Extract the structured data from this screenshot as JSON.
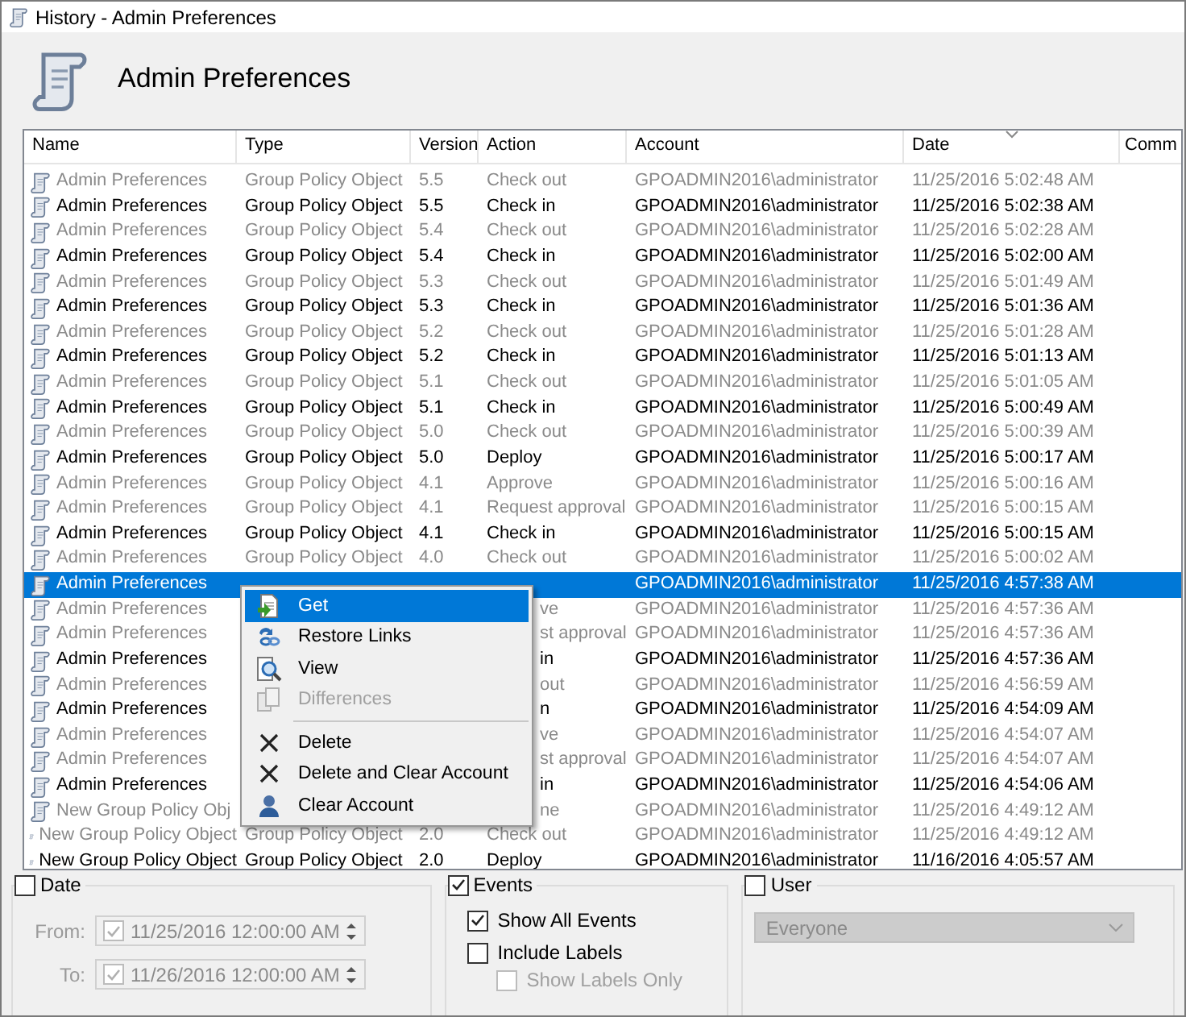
{
  "window": {
    "title": "History - Admin Preferences"
  },
  "header": {
    "title": "Admin Preferences"
  },
  "table": {
    "columns": [
      {
        "label": "Name",
        "sorted": false
      },
      {
        "label": "Type",
        "sorted": false
      },
      {
        "label": "Version",
        "sorted": false
      },
      {
        "label": "Action",
        "sorted": false
      },
      {
        "label": "Account",
        "sorted": false
      },
      {
        "label": "Date",
        "sorted": true
      },
      {
        "label": "Comm",
        "sorted": false
      }
    ],
    "rows": [
      {
        "kind": "past",
        "selected": false,
        "name": "Admin Preferences",
        "type": "Group Policy Object",
        "version": "5.5",
        "action": "Check out",
        "account": "GPOADMIN2016\\administrator",
        "date": "11/25/2016 5:02:48 AM"
      },
      {
        "kind": "current",
        "selected": false,
        "name": "Admin Preferences",
        "type": "Group Policy Object",
        "version": "5.5",
        "action": "Check in",
        "account": "GPOADMIN2016\\administrator",
        "date": "11/25/2016 5:02:38 AM"
      },
      {
        "kind": "past",
        "selected": false,
        "name": "Admin Preferences",
        "type": "Group Policy Object",
        "version": "5.4",
        "action": "Check out",
        "account": "GPOADMIN2016\\administrator",
        "date": "11/25/2016 5:02:28 AM"
      },
      {
        "kind": "current",
        "selected": false,
        "name": "Admin Preferences",
        "type": "Group Policy Object",
        "version": "5.4",
        "action": "Check in",
        "account": "GPOADMIN2016\\administrator",
        "date": "11/25/2016 5:02:00 AM"
      },
      {
        "kind": "past",
        "selected": false,
        "name": "Admin Preferences",
        "type": "Group Policy Object",
        "version": "5.3",
        "action": "Check out",
        "account": "GPOADMIN2016\\administrator",
        "date": "11/25/2016 5:01:49 AM"
      },
      {
        "kind": "current",
        "selected": false,
        "name": "Admin Preferences",
        "type": "Group Policy Object",
        "version": "5.3",
        "action": "Check in",
        "account": "GPOADMIN2016\\administrator",
        "date": "11/25/2016 5:01:36 AM"
      },
      {
        "kind": "past",
        "selected": false,
        "name": "Admin Preferences",
        "type": "Group Policy Object",
        "version": "5.2",
        "action": "Check out",
        "account": "GPOADMIN2016\\administrator",
        "date": "11/25/2016 5:01:28 AM"
      },
      {
        "kind": "current",
        "selected": false,
        "name": "Admin Preferences",
        "type": "Group Policy Object",
        "version": "5.2",
        "action": "Check in",
        "account": "GPOADMIN2016\\administrator",
        "date": "11/25/2016 5:01:13 AM"
      },
      {
        "kind": "past",
        "selected": false,
        "name": "Admin Preferences",
        "type": "Group Policy Object",
        "version": "5.1",
        "action": "Check out",
        "account": "GPOADMIN2016\\administrator",
        "date": "11/25/2016 5:01:05 AM"
      },
      {
        "kind": "current",
        "selected": false,
        "name": "Admin Preferences",
        "type": "Group Policy Object",
        "version": "5.1",
        "action": "Check in",
        "account": "GPOADMIN2016\\administrator",
        "date": "11/25/2016 5:00:49 AM"
      },
      {
        "kind": "past",
        "selected": false,
        "name": "Admin Preferences",
        "type": "Group Policy Object",
        "version": "5.0",
        "action": "Check out",
        "account": "GPOADMIN2016\\administrator",
        "date": "11/25/2016 5:00:39 AM"
      },
      {
        "kind": "current",
        "selected": false,
        "name": "Admin Preferences",
        "type": "Group Policy Object",
        "version": "5.0",
        "action": "Deploy",
        "account": "GPOADMIN2016\\administrator",
        "date": "11/25/2016 5:00:17 AM"
      },
      {
        "kind": "past",
        "selected": false,
        "name": "Admin Preferences",
        "type": "Group Policy Object",
        "version": "4.1",
        "action": "Approve",
        "account": "GPOADMIN2016\\administrator",
        "date": "11/25/2016 5:00:16 AM"
      },
      {
        "kind": "past",
        "selected": false,
        "name": "Admin Preferences",
        "type": "Group Policy Object",
        "version": "4.1",
        "action": "Request approval",
        "account": "GPOADMIN2016\\administrator",
        "date": "11/25/2016 5:00:15 AM"
      },
      {
        "kind": "current",
        "selected": false,
        "name": "Admin Preferences",
        "type": "Group Policy Object",
        "version": "4.1",
        "action": "Check in",
        "account": "GPOADMIN2016\\administrator",
        "date": "11/25/2016 5:00:15 AM"
      },
      {
        "kind": "past",
        "selected": false,
        "name": "Admin Preferences",
        "type": "Group Policy Object",
        "version": "4.0",
        "action": "Check out",
        "account": "GPOADMIN2016\\administrator",
        "date": "11/25/2016 5:00:02 AM"
      },
      {
        "kind": "current",
        "selected": true,
        "name": "Admin Preferences",
        "account": "GPOADMIN2016\\administrator",
        "date": "11/25/2016 4:57:38 AM"
      },
      {
        "kind": "past",
        "selected": false,
        "name": "Admin Preferences",
        "action": "ve",
        "account": "GPOADMIN2016\\administrator",
        "date": "11/25/2016 4:57:36 AM"
      },
      {
        "kind": "past",
        "selected": false,
        "name": "Admin Preferences",
        "action": "st approval",
        "account": "GPOADMIN2016\\administrator",
        "date": "11/25/2016 4:57:36 AM"
      },
      {
        "kind": "current",
        "selected": false,
        "name": "Admin Preferences",
        "action": "in",
        "account": "GPOADMIN2016\\administrator",
        "date": "11/25/2016 4:57:36 AM"
      },
      {
        "kind": "past",
        "selected": false,
        "name": "Admin Preferences",
        "action": "out",
        "account": "GPOADMIN2016\\administrator",
        "date": "11/25/2016 4:56:59 AM"
      },
      {
        "kind": "current",
        "selected": false,
        "name": "Admin Preferences",
        "action": "n",
        "account": "GPOADMIN2016\\administrator",
        "date": "11/25/2016 4:54:09 AM"
      },
      {
        "kind": "past",
        "selected": false,
        "name": "Admin Preferences",
        "action": "ve",
        "account": "GPOADMIN2016\\administrator",
        "date": "11/25/2016 4:54:07 AM"
      },
      {
        "kind": "past",
        "selected": false,
        "name": "Admin Preferences",
        "action": "st approval",
        "account": "GPOADMIN2016\\administrator",
        "date": "11/25/2016 4:54:07 AM"
      },
      {
        "kind": "current",
        "selected": false,
        "name": "Admin Preferences",
        "action": "in",
        "account": "GPOADMIN2016\\administrator",
        "date": "11/25/2016 4:54:06 AM"
      },
      {
        "kind": "past",
        "selected": false,
        "name": "New Group Policy Obj",
        "action": "ne",
        "account": "GPOADMIN2016\\administrator",
        "date": "11/25/2016 4:49:12 AM"
      },
      {
        "kind": "past",
        "selected": false,
        "name": "New Group Policy Object",
        "type": "Group Policy Object",
        "version": "2.0",
        "action": "Check out",
        "account": "GPOADMIN2016\\administrator",
        "date": "11/25/2016 4:49:12 AM"
      },
      {
        "kind": "current",
        "selected": false,
        "name": "New Group Policy Object",
        "type": "Group Policy Object",
        "version": "2.0",
        "action": "Deploy",
        "account": "GPOADMIN2016\\administrator",
        "date": "11/16/2016 4:05:57 AM"
      }
    ]
  },
  "context_menu": {
    "items": [
      {
        "kind": "get",
        "label": "Get",
        "selected": true,
        "disabled": false
      },
      {
        "kind": "links",
        "label": "Restore Links",
        "selected": false,
        "disabled": false
      },
      {
        "kind": "view",
        "label": "View",
        "selected": false,
        "disabled": false
      },
      {
        "kind": "diff",
        "label": "Differences",
        "selected": false,
        "disabled": true
      },
      {
        "kind": "separator"
      },
      {
        "kind": "delete",
        "label": "Delete",
        "selected": false,
        "disabled": false
      },
      {
        "kind": "delete",
        "label": "Delete and Clear Account",
        "selected": false,
        "disabled": false
      },
      {
        "kind": "user",
        "label": "Clear Account",
        "selected": false,
        "disabled": false
      }
    ]
  },
  "filters": {
    "date": {
      "label": "Date",
      "checked": false,
      "from": {
        "label": "From:",
        "checked": true,
        "value": "11/25/2016 12:00:00 AM"
      },
      "to": {
        "label": "To:",
        "checked": true,
        "value": "11/26/2016 12:00:00 AM"
      }
    },
    "events": {
      "label": "Events",
      "checked": true,
      "options": [
        {
          "label": "Show All Events",
          "checked": true,
          "disabled": false
        },
        {
          "label": "Include Labels",
          "checked": false,
          "disabled": false,
          "children": [
            {
              "label": "Show Labels Only",
              "checked": false,
              "disabled": true
            }
          ]
        }
      ]
    },
    "user": {
      "label": "User",
      "checked": false,
      "value": "Everyone"
    }
  }
}
